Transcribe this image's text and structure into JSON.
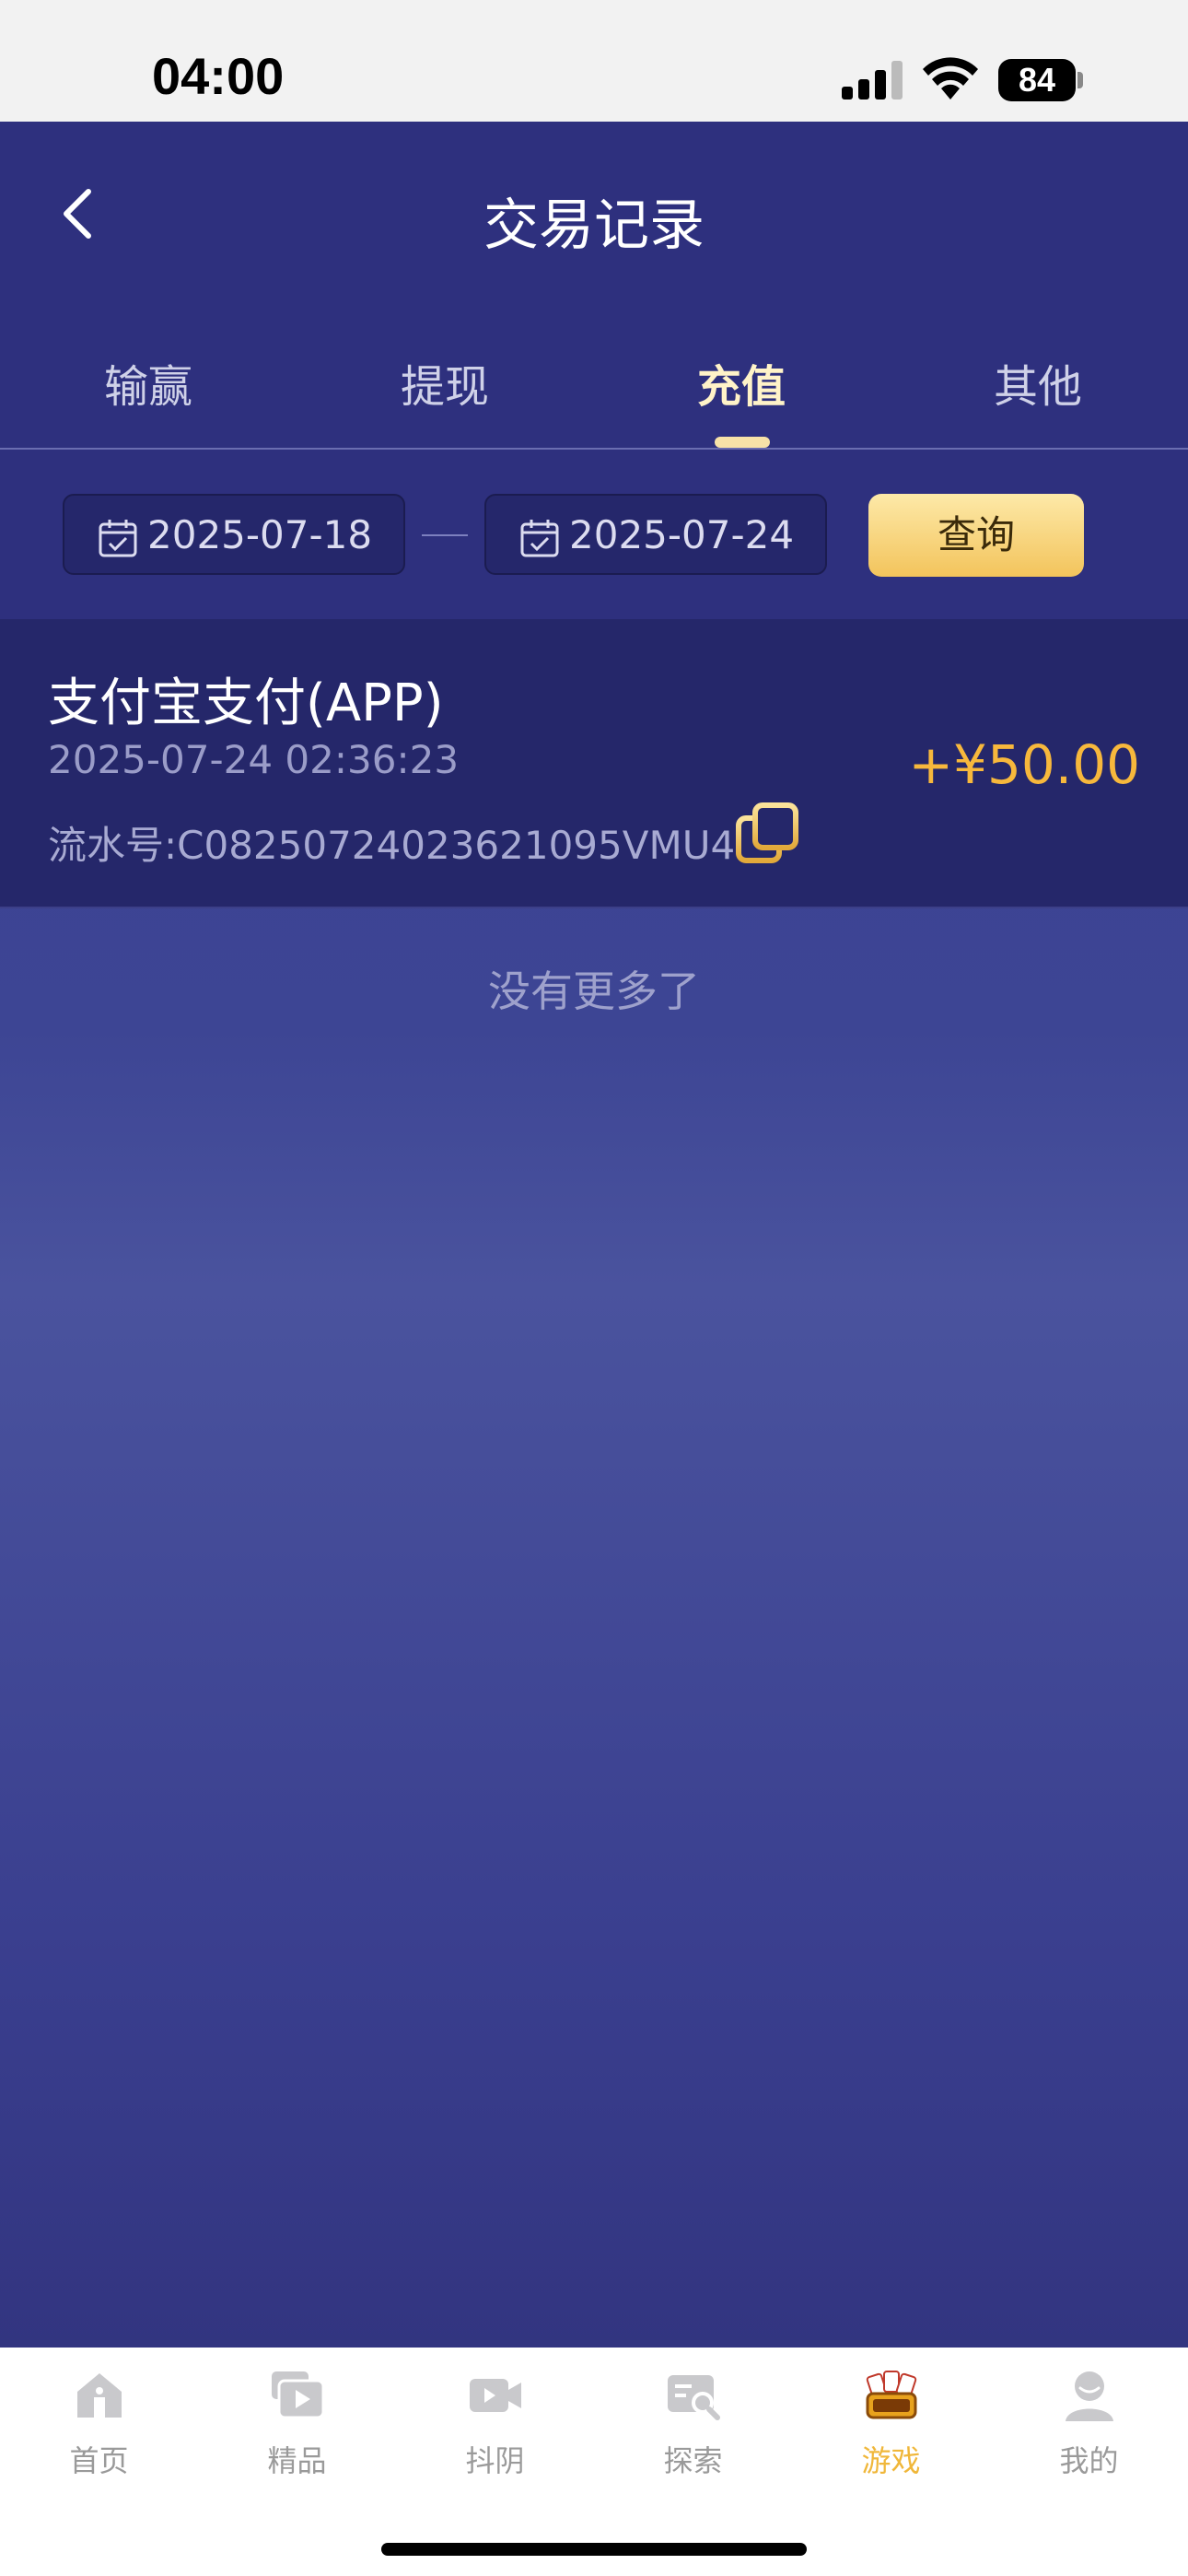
{
  "status": {
    "time": "04:00",
    "battery": "84"
  },
  "header": {
    "title": "交易记录"
  },
  "tabs": [
    {
      "label": "输赢",
      "active": false
    },
    {
      "label": "提现",
      "active": false
    },
    {
      "label": "充值",
      "active": true
    },
    {
      "label": "其他",
      "active": false
    }
  ],
  "filter": {
    "start_date": "2025-07-18",
    "end_date": "2025-07-24",
    "query_label": "查询"
  },
  "records": [
    {
      "title": "支付宝支付(APP)",
      "time": "2025-07-24 02:36:23",
      "serial": "流水号:C08250724023621095VMU4",
      "amount": "+¥50.00"
    }
  ],
  "list_end_text": "没有更多了",
  "bottom_nav": [
    {
      "label": "首页",
      "icon": "home-icon"
    },
    {
      "label": "精品",
      "icon": "video-stack-icon"
    },
    {
      "label": "抖阴",
      "icon": "video-camera-icon"
    },
    {
      "label": "探索",
      "icon": "explore-search-icon"
    },
    {
      "label": "游戏",
      "icon": "chess-cards-game-icon",
      "active": true
    },
    {
      "label": "我的",
      "icon": "user-icon"
    }
  ],
  "colors": {
    "accent": "#f7b83c",
    "header_bg": "#2e307e",
    "active_tab": "#fff3c8",
    "nav_active": "#f0b73a"
  }
}
